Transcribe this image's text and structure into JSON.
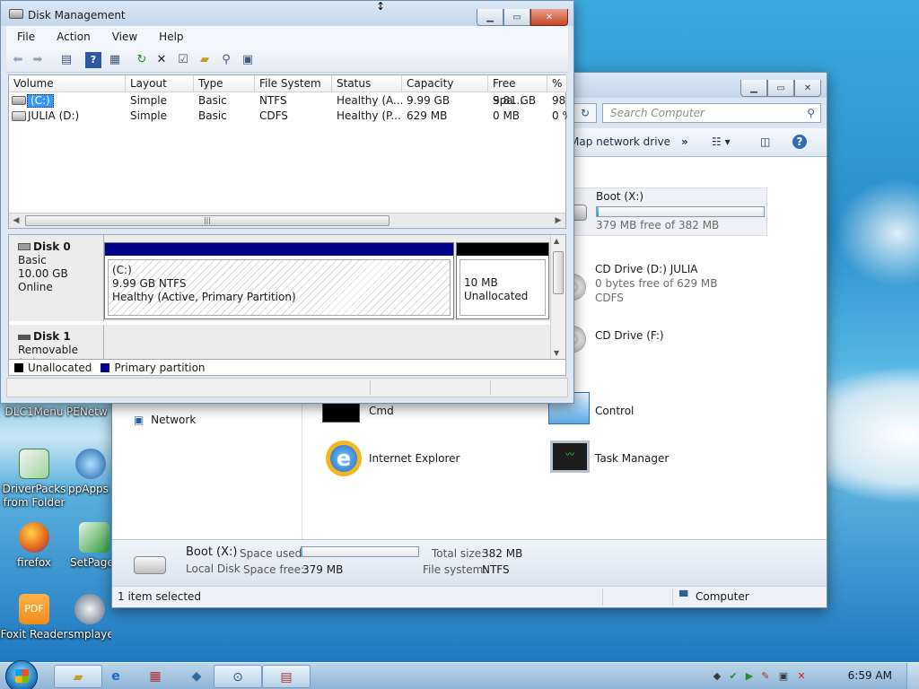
{
  "desktop": {
    "icons": [
      {
        "label": "DLC1Menu",
        "color": "#3a70b3"
      },
      {
        "label": "PENetw",
        "color": "#3a70b3"
      },
      {
        "label": "DriverPacks from Folder",
        "color": "#2ea44f"
      },
      {
        "label": "ppApps",
        "color": "#1f5fa8"
      },
      {
        "label": "firefox",
        "color": "#e66b1a"
      },
      {
        "label": "SetPage",
        "color": "#2c9b3c"
      },
      {
        "label": "Foxit Reader",
        "color": "#f08c1c"
      },
      {
        "label": "smplayer",
        "color": "#5d6d80"
      }
    ]
  },
  "explorer": {
    "search_placeholder": "Search Computer",
    "toolbar": {
      "map_drive": "Map network drive",
      "more": "»"
    },
    "nav": {
      "network": "Network"
    },
    "drives": [
      {
        "name": "Boot (X:)",
        "free_text": "379 MB free of 382 MB",
        "used_fraction": 0.01
      },
      {
        "name": "CD Drive (D:) JULIA",
        "free_text": "0 bytes free of 629 MB",
        "fs": "CDFS"
      },
      {
        "name": "CD Drive (F:)"
      }
    ],
    "apps": [
      {
        "label": "Cmd"
      },
      {
        "label": "Control"
      },
      {
        "label": "Internet Explorer"
      },
      {
        "label": "Task Manager"
      }
    ],
    "details": {
      "name": "Boot (X:)",
      "type": "Local Disk",
      "space_used_label": "Space used:",
      "space_used_fraction": 0.01,
      "space_free_label": "Space free:",
      "space_free": "379 MB",
      "total_size_label": "Total size:",
      "total_size": "382 MB",
      "fs_label": "File system:",
      "fs": "NTFS"
    },
    "status": {
      "selected": "1 item selected",
      "location": "Computer"
    }
  },
  "disk_mgmt": {
    "title": "Disk Management",
    "menu": [
      "File",
      "Action",
      "View",
      "Help"
    ],
    "columns": [
      "Volume",
      "Layout",
      "Type",
      "File System",
      "Status",
      "Capacity",
      "Free Spa...",
      "% F"
    ],
    "rows": [
      [
        "(C:)",
        "Simple",
        "Basic",
        "NTFS",
        "Healthy (A...",
        "9.99 GB",
        "9.81 GB",
        "98"
      ],
      [
        "JULIA (D:)",
        "Simple",
        "Basic",
        "CDFS",
        "Healthy (P...",
        "629 MB",
        "0 MB",
        "0 %"
      ]
    ],
    "disks": [
      {
        "name": "Disk 0",
        "kind": "Basic",
        "size": "10.00 GB",
        "state": "Online",
        "partitions": [
          {
            "title": "(C:)",
            "line2": "9.99 GB NTFS",
            "line3": "Healthy (Active, Primary Partition)"
          },
          {
            "title": "",
            "line2": "10 MB",
            "line3": "Unallocated"
          }
        ]
      },
      {
        "name": "Disk 1",
        "kind": "Removable (E:)"
      }
    ],
    "legend": [
      {
        "label": "Unallocated",
        "color": "#000000"
      },
      {
        "label": "Primary partition",
        "color": "#00008b"
      }
    ]
  },
  "taskbar": {
    "clock": "6:59 AM"
  }
}
